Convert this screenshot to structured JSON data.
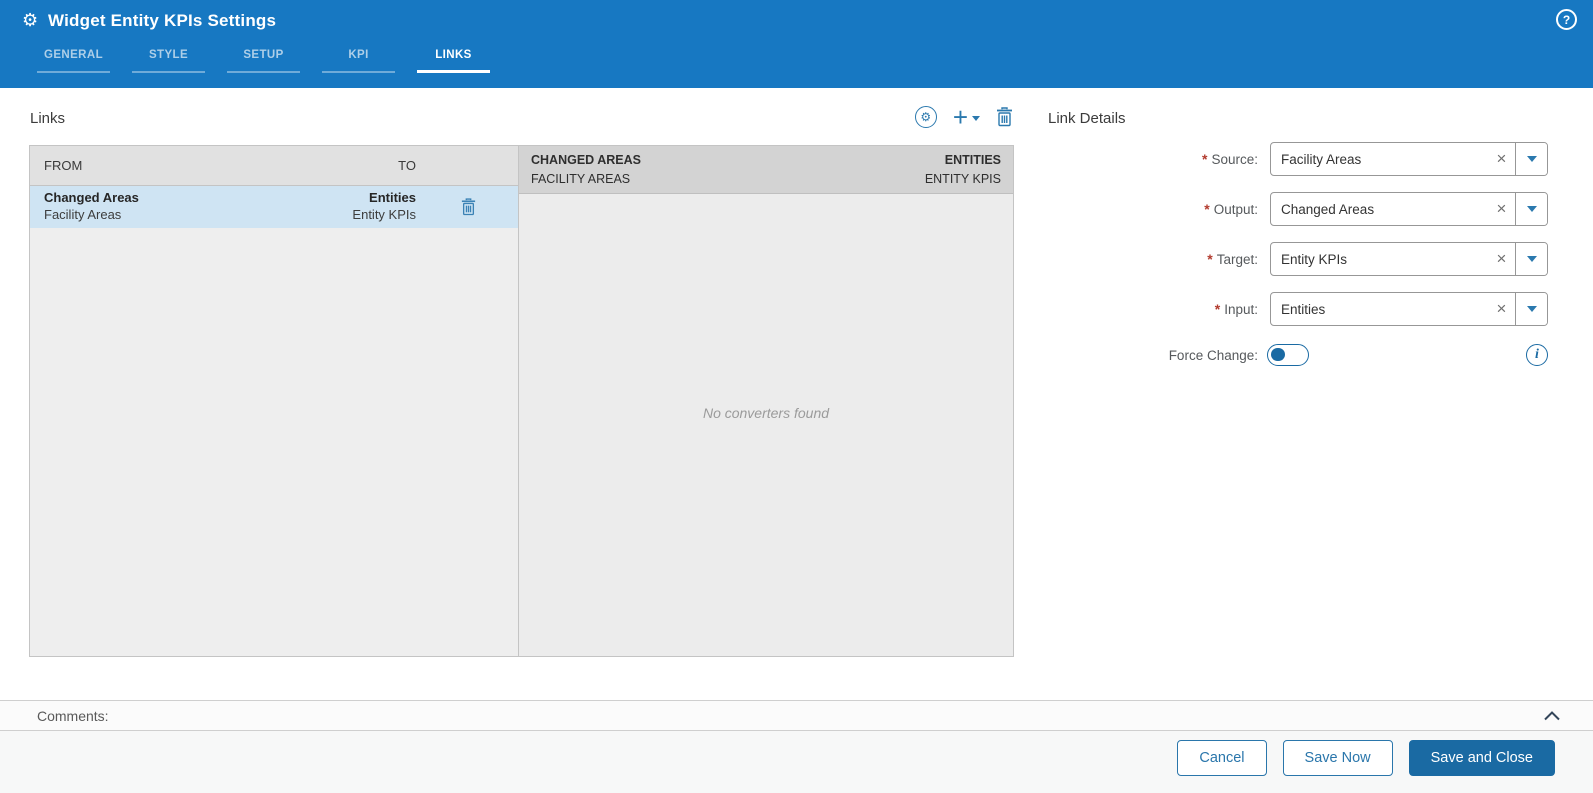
{
  "colors": {
    "header_bg": "#1778c2",
    "accent_blue": "#1a6aa3",
    "icon_blue": "#2b79ae",
    "selected_row_bg": "#cfe4f3",
    "required_red": "#b23b2e"
  },
  "header": {
    "title": "Widget Entity KPIs Settings",
    "tabs": [
      {
        "label": "GENERAL",
        "active": false
      },
      {
        "label": "STYLE",
        "active": false
      },
      {
        "label": "SETUP",
        "active": false
      },
      {
        "label": "KPI",
        "active": false
      },
      {
        "label": "LINKS",
        "active": true
      }
    ]
  },
  "icons": {
    "settings_gear": "⚙",
    "help": "?",
    "auto_link_gear": "⚙",
    "add_plus": "+",
    "clear_x": "×",
    "info": "i"
  },
  "links_panel": {
    "title": "Links",
    "columns": {
      "from": "FROM",
      "to": "TO"
    },
    "rows": [
      {
        "from_primary": "Changed Areas",
        "from_secondary": "Facility Areas",
        "to_primary": "Entities",
        "to_secondary": "Entity KPIs",
        "selected": true
      }
    ]
  },
  "converters_panel": {
    "from_title": "CHANGED AREAS",
    "from_subtitle": "FACILITY AREAS",
    "to_title": "ENTITIES",
    "to_subtitle": "ENTITY KPIS",
    "empty_message": "No converters found"
  },
  "link_details": {
    "title": "Link Details",
    "required_marker": "*",
    "fields": [
      {
        "label": "Source:",
        "value": "Facility Areas"
      },
      {
        "label": "Output:",
        "value": "Changed Areas"
      },
      {
        "label": "Target:",
        "value": "Entity KPIs"
      },
      {
        "label": "Input:",
        "value": "Entities"
      }
    ],
    "force_change": {
      "label": "Force Change:",
      "state": "off"
    }
  },
  "comments": {
    "label": "Comments:"
  },
  "footer": {
    "cancel_label": "Cancel",
    "save_now_label": "Save Now",
    "save_and_close_label": "Save and Close"
  }
}
